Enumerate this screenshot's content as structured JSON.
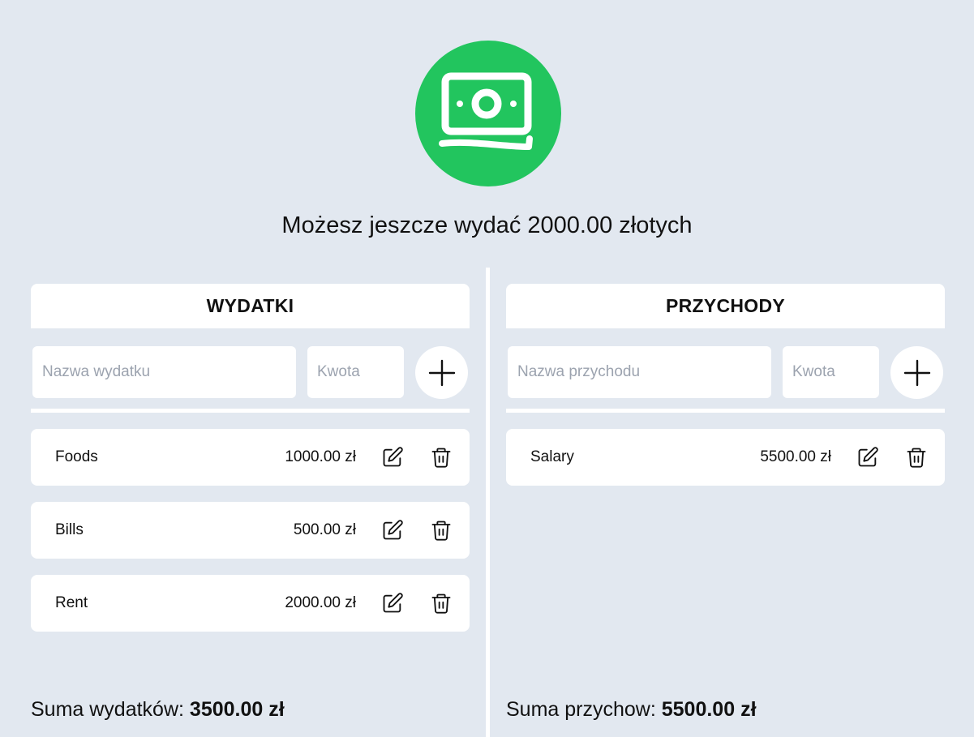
{
  "app": {
    "logo_icon": "money-bill-icon",
    "accent_color": "#22c55e",
    "headline": "Możesz jeszcze wydać 2000.00 złotych"
  },
  "expenses": {
    "title": "WYDATKI",
    "name_placeholder": "Nazwa wydatku",
    "amount_placeholder": "Kwota",
    "add_icon": "plus-icon",
    "items": [
      {
        "name": "Foods",
        "amount": "1000.00 zł"
      },
      {
        "name": "Bills",
        "amount": "500.00 zł"
      },
      {
        "name": "Rent",
        "amount": "2000.00 zł"
      }
    ],
    "sum_label": "Suma wydatków:",
    "sum_value": "3500.00 zł"
  },
  "incomes": {
    "title": "PRZYCHODY",
    "name_placeholder": "Nazwa przychodu",
    "amount_placeholder": "Kwota",
    "add_icon": "plus-icon",
    "items": [
      {
        "name": "Salary",
        "amount": "5500.00 zł"
      }
    ],
    "sum_label": "Suma przychow:",
    "sum_value": "5500.00 zł"
  },
  "icons": {
    "edit": "pencil-square-icon",
    "delete": "trash-icon"
  }
}
